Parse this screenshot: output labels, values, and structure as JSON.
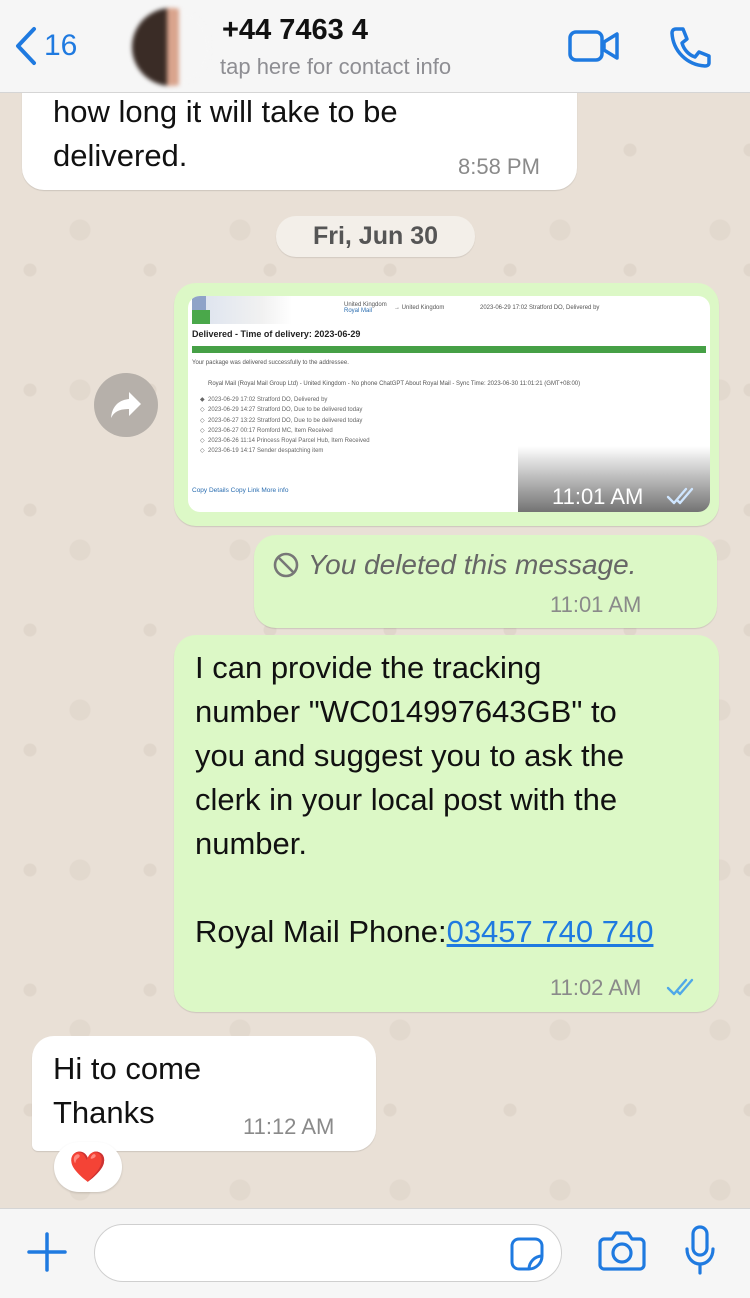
{
  "header": {
    "back_count": "16",
    "contact_name": "+44 7463 4",
    "contact_subtitle": "tap here for contact info"
  },
  "messages": [
    {
      "id": "m1",
      "direction": "incoming",
      "text": "how long it will take to be\ndelivered.",
      "time": "8:58 PM"
    },
    {
      "id": "m3",
      "direction": "outgoing",
      "type": "image",
      "time": "11:01 AM",
      "status": "read"
    },
    {
      "id": "m4",
      "direction": "outgoing",
      "type": "deleted",
      "text": "You deleted this message.",
      "time": "11:01 AM"
    },
    {
      "id": "m5",
      "direction": "outgoing",
      "text": "I can provide the tracking\nnumber \"WC014997643GB\" to\nyou and suggest you to ask the\nclerk in your local post with the\nnumber.\n\nRoyal Mail Phone:",
      "link": "03457 740 740",
      "time": "11:02 AM",
      "status": "read"
    },
    {
      "id": "m6",
      "direction": "incoming",
      "text": "Hi to come\nThanks",
      "time": "11:12 AM",
      "reaction": "❤️"
    }
  ],
  "day_separator": "Fri, Jun 30",
  "tracking_screenshot": {
    "origin": "United Kingdom",
    "origin_carrier": "Royal Mail",
    "destination": "United Kingdom",
    "latest_status": "2023-06-29 17:02  Stratford DO, Delivered by",
    "title": "Delivered - Time of delivery:  2023-06-29",
    "description": "Your package was delivered successfully to the addressee.",
    "carrier_line": "Royal Mail (Royal Mail Group Ltd) - United Kingdom - No phone  ChatGPT About Royal Mail - Sync Time: 2023-06-30 11:01:21 (GMT+08:00)",
    "events": [
      "2023-06-29 17:02   Stratford DO, Delivered by",
      "2023-06-29 14:27   Stratford DO, Due to be delivered today",
      "2023-06-27 13:22   Stratford DO, Due to be delivered today",
      "2023-06-27 00:17   Romford MC, Item Received",
      "2023-06-26 11:14   Princess Royal Parcel Hub, Item Received",
      "2023-06-19 14:17   Sender despatching item"
    ],
    "footer": "Copy Details     Copy Link     More info"
  },
  "icons": {
    "back": "chevron-left-icon",
    "video": "video-call-icon",
    "phone": "phone-icon",
    "forward": "forward-arrow-icon",
    "deleted": "prohibited-icon",
    "attach": "plus-icon",
    "sticker": "sticker-icon",
    "camera": "camera-icon",
    "mic": "microphone-icon"
  },
  "colors": {
    "accent": "#1f7ae0",
    "outgoing_bubble": "#dcf8c6",
    "incoming_bubble": "#ffffff",
    "read_ticks": "#4fa8e8"
  }
}
